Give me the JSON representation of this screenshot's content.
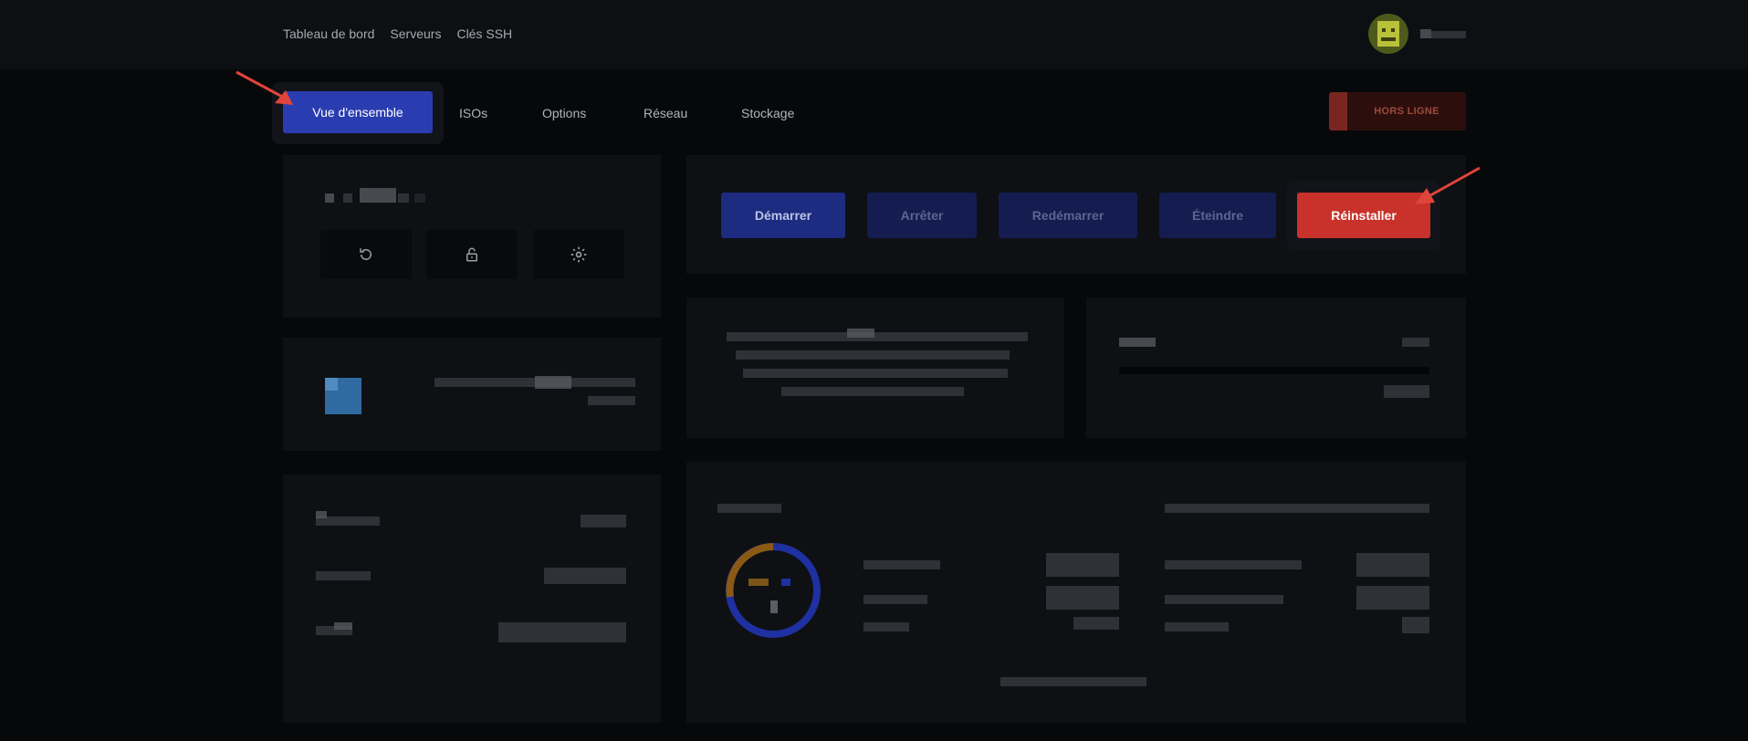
{
  "topnav": {
    "items": [
      "Tableau de bord",
      "Serveurs",
      "Clés SSH"
    ]
  },
  "tabs": {
    "active": "Vue d'ensemble",
    "items": [
      "ISOs",
      "Options",
      "Réseau",
      "Stockage"
    ]
  },
  "status": {
    "label": "HORS LIGNE"
  },
  "quick_actions": {
    "icons": [
      "refresh-icon",
      "lock-icon",
      "gear-icon"
    ]
  },
  "actions": {
    "start": "Démarrer",
    "stop": "Arrêter",
    "restart": "Redémarrer",
    "shutdown": "Éteindre",
    "reinstall": "Réinstaller"
  },
  "colors": {
    "accent": "#2a3db0",
    "danger": "#c8322a",
    "annotation": "#e0453a"
  }
}
